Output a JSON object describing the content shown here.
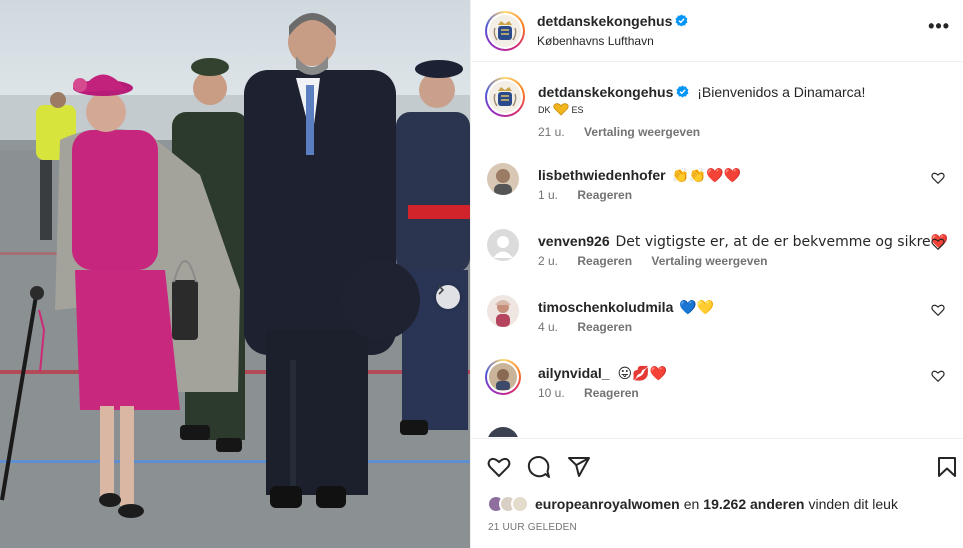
{
  "post": {
    "username": "detdanskekongehus",
    "location": "Københavns Lufthavn",
    "caption": "¡Bienvenidos a Dinamarca!",
    "caption_flags": {
      "left": "DK",
      "right": "ES"
    },
    "caption_age": "21 u.",
    "caption_translate": "Vertaling weergeven",
    "more_label": "•••"
  },
  "comments": [
    {
      "username": "lisbethwiedenhofer",
      "text": "👏👏❤️❤️",
      "age": "1 u.",
      "reply": "Reageren",
      "translate": ""
    },
    {
      "username": "venven926",
      "text": "Det vigtigste er, at de er bekvemme og sikre❤️",
      "age": "2 u.",
      "reply": "Reageren",
      "translate": "Vertaling weergeven"
    },
    {
      "username": "timoschenkoludmila",
      "text": "💙💛",
      "age": "4 u.",
      "reply": "Reageren",
      "translate": ""
    },
    {
      "username": "ailynvidal_",
      "text": "😛💋❤️",
      "age": "10 u.",
      "reply": "Reageren",
      "translate": ""
    }
  ],
  "likes": {
    "first_user": "europeanroyalwomen",
    "connector": "en",
    "count": "19.262 anderen",
    "suffix": "vinden dit leuk"
  },
  "time_ago": "21 UUR GELEDEN",
  "icons": [
    "verified-badge-icon",
    "more-options-icon",
    "heart-icon",
    "comment-icon",
    "share-icon",
    "bookmark-icon",
    "chevron-right-icon"
  ],
  "colors": {
    "verified": "#0095f6",
    "muted": "#737373",
    "heart": "#e0245e"
  }
}
